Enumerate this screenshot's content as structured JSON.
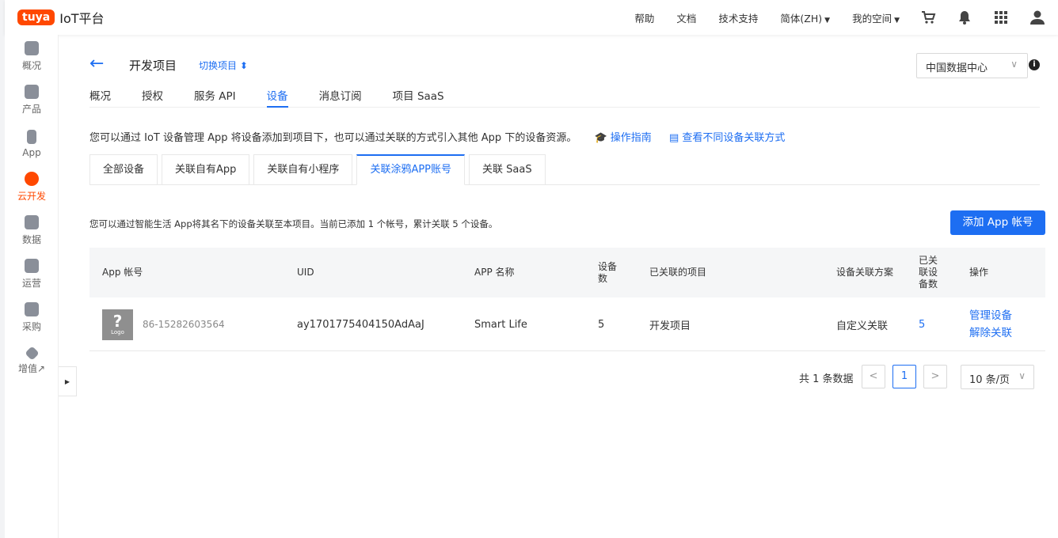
{
  "topbar": {
    "logo_badge": "tuya",
    "logo_text": "IoT平台",
    "nav": [
      "帮助",
      "文档",
      "技术支持"
    ],
    "lang": "简体(ZH)",
    "space": "我的空间",
    "icons": [
      "cart-icon",
      "bell-icon",
      "apps-grid-icon",
      "user-icon"
    ]
  },
  "sidebar": {
    "items": [
      {
        "label": "概况",
        "icon": "home-icon"
      },
      {
        "label": "产品",
        "icon": "terminal-icon"
      },
      {
        "label": "App",
        "icon": "phone-icon"
      },
      {
        "label": "云开发",
        "icon": "cloud-icon",
        "active": true
      },
      {
        "label": "数据",
        "icon": "chart-icon"
      },
      {
        "label": "运营",
        "icon": "star-icon"
      },
      {
        "label": "采购",
        "icon": "box-icon"
      },
      {
        "label": "增值↗",
        "icon": "diamond-icon"
      }
    ]
  },
  "header": {
    "back": "←",
    "title": "开发项目",
    "switch": "切换项目 ⬍",
    "data_center": "中国数据中心"
  },
  "tabs": [
    "概况",
    "授权",
    "服务 API",
    "设备",
    "消息订阅",
    "项目 SaaS"
  ],
  "active_tab": 3,
  "description": {
    "text": "您可以通过 IoT 设备管理 App 将设备添加到项目下，也可以通过关联的方式引入其他 App 下的设备资源。",
    "guide": "操作指南",
    "methods": "查看不同设备关联方式"
  },
  "subtabs": [
    "全部设备",
    "关联自有App",
    "关联自有小程序",
    "关联涂鸦APP账号",
    "关联 SaaS"
  ],
  "active_subtab": 3,
  "subdesc": "您可以通过智能生活 App将其名下的设备关联至本项目。当前已添加 1 个帐号，累计关联 5 个设备。",
  "add_button": "添加 App 帐号",
  "table": {
    "headers": [
      "App 帐号",
      "UID",
      "APP 名称",
      "设备数",
      "已关联的项目",
      "设备关联方案",
      "已关联设备数",
      "操作"
    ],
    "rows": [
      {
        "logo": "?",
        "logo_sub": "Logo",
        "account": "86-15282603564",
        "uid": "ay1701775404150AdAaJ",
        "app_name": "Smart Life",
        "device_count": "5",
        "project": "开发项目",
        "scheme": "自定义关联",
        "linked_count": "5",
        "op_manage": "管理设备",
        "op_unlink": "解除关联"
      }
    ]
  },
  "pagination": {
    "total": "共 1 条数据",
    "prev": "<",
    "current": "1",
    "next": ">",
    "page_size": "10 条/页"
  }
}
